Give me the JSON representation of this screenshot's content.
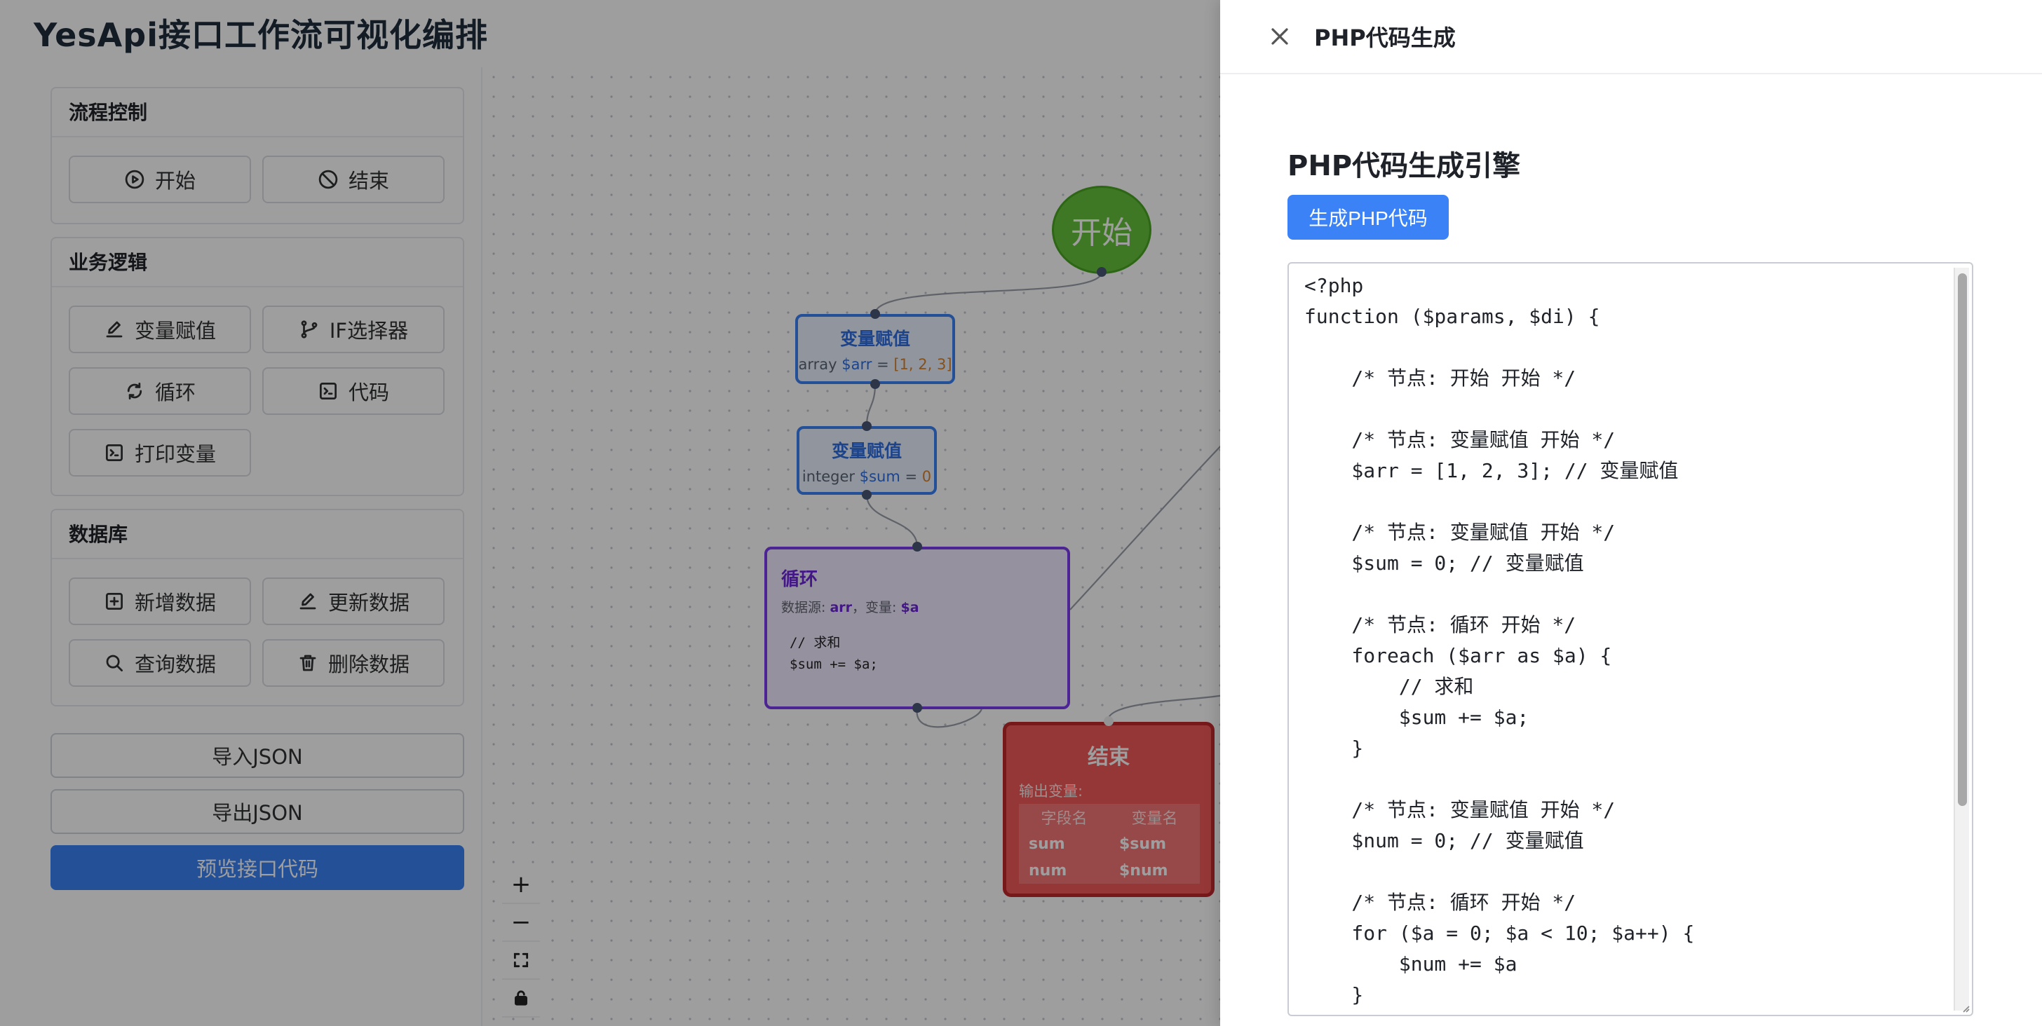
{
  "app": {
    "title": "YesApi接口工作流可视化编排"
  },
  "sidebar": {
    "flow_control": {
      "title": "流程控制",
      "start": "开始",
      "end": "结束"
    },
    "business": {
      "title": "业务逻辑",
      "assign": "变量赋值",
      "if": "IF选择器",
      "loop": "循环",
      "code": "代码",
      "print": "打印变量"
    },
    "database": {
      "title": "数据库",
      "insert": "新增数据",
      "update": "更新数据",
      "query": "查询数据",
      "delete": "删除数据"
    },
    "import_json": "导入JSON",
    "export_json": "导出JSON",
    "preview_code": "预览接口代码"
  },
  "canvas": {
    "start_node": {
      "label": "开始"
    },
    "assign1": {
      "title": "变量赋值",
      "type": "array",
      "var": "$arr",
      "eq": " = ",
      "value": "[1, 2, 3]"
    },
    "assign2": {
      "title": "变量赋值",
      "type": "integer",
      "var": "$sum",
      "eq": " = ",
      "value": "0"
    },
    "loop": {
      "title": "循环",
      "source_label": "数据源: ",
      "source": "arr",
      "var_label": "，变量: ",
      "var": "$a",
      "code": "// 求和\n$sum += $a;"
    },
    "end_node": {
      "title": "结束",
      "output_label": "输出变量:",
      "columns": [
        "字段名",
        "变量名"
      ],
      "rows": [
        {
          "field": "sum",
          "var": "$sum"
        },
        {
          "field": "num",
          "var": "$num"
        }
      ]
    },
    "controls": {
      "zoom_in": "+",
      "zoom_out": "−"
    }
  },
  "drawer": {
    "title": "PHP代码生成",
    "engine_title": "PHP代码生成引擎",
    "generate_button": "生成PHP代码",
    "code": "<?php\nfunction ($params, $di) {\n\n    /* 节点: 开始 开始 */\n\n    /* 节点: 变量赋值 开始 */\n    $arr = [1, 2, 3]; // 变量赋值\n\n    /* 节点: 变量赋值 开始 */\n    $sum = 0; // 变量赋值\n\n    /* 节点: 循环 开始 */\n    foreach ($arr as $a) {\n        // 求和\n        $sum += $a;\n    }\n\n    /* 节点: 变量赋值 开始 */\n    $num = 0; // 变量赋值\n\n    /* 节点: 循环 开始 */\n    for ($a = 0; $a < 10; $a++) {\n        $num += $a\n    }"
  },
  "colors": {
    "primary": "#3b82f6",
    "start_green": "#67c23a",
    "loop_purple": "#7c3aed",
    "end_red": "#f25a5a"
  }
}
